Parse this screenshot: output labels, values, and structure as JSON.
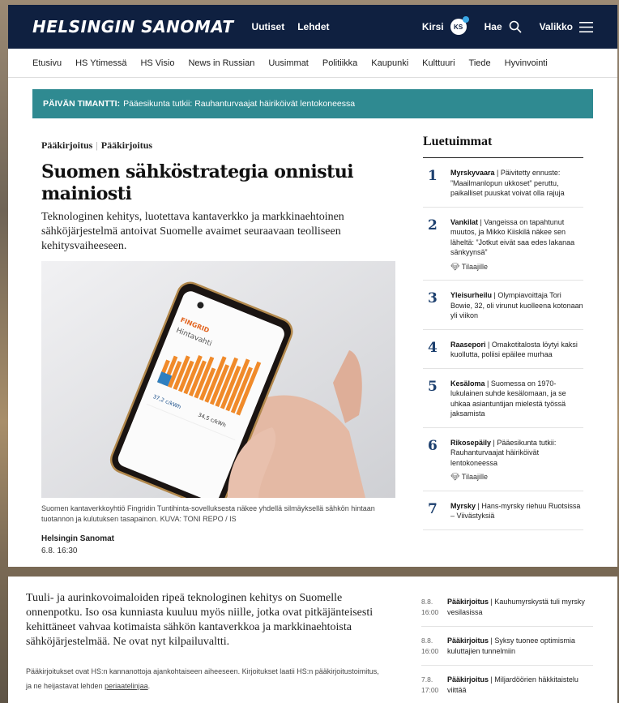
{
  "header": {
    "logo": "HELSINGIN SANOMAT",
    "links": [
      "Uutiset",
      "Lehdet"
    ],
    "user_name": "Kirsi",
    "user_initials": "KS",
    "search_label": "Hae",
    "menu_label": "Valikko"
  },
  "subnav": [
    "Etusivu",
    "HS Ytimessä",
    "HS Visio",
    "News in Russian",
    "Uusimmat",
    "Politiikka",
    "Kaupunki",
    "Kulttuuri",
    "Tiede",
    "Hyvinvointi"
  ],
  "banner": {
    "label": "PÄIVÄN TIMANTTI:",
    "text": "Pääesikunta tutkii: Rauhanturvaajat häiriköivät lentokoneessa"
  },
  "article": {
    "kicker_1": "Pääkirjoitus",
    "kicker_sep": "|",
    "kicker_2": "Pääkirjoitus",
    "title": "Suomen sähköstrategia onnistui mainiosti",
    "lead": "Teknologinen kehitys, luotettava kantaverkko ja markkinaehtoinen sähköjärjestelmä antoivat Suomelle avaimet seuraavaan teolliseen kehitysvaiheeseen.",
    "image": {
      "app_brand": "FINGRID",
      "app_title": "Hintavahti",
      "value_1": "37,2 c/kWh",
      "value_2": "34,5 c/kWh"
    },
    "caption": "Suomen kantaverkkoyhtiö Fingridin Tuntihinta-sovelluksesta näkee yhdellä silmäyksellä sähkön hintaan tuotannon ja kulutuksen tasapainon. KUVA: TONI REPO / IS",
    "byline": "Helsingin Sanomat",
    "date": "6.8. 16:30",
    "body": "Tuuli- ja aurinkovoimaloiden ripeä teknologinen kehitys on Suomelle onnenpotku. Iso osa kunniasta kuuluu myös niille, jotka ovat pitkäjänteisesti kehittäneet vahvaa kotimaista sähkön kantaverkkoa ja markkinaehtoista sähköjärjestelmää. Ne ovat nyt kilpailuvaltti.",
    "note_text": "Pääkirjoitukset ovat HS:n kannanottoja ajankohtaiseen aiheeseen. Kirjoitukset laatii HS:n pääkirjoitustoimitus, ja ne heijastavat lehden",
    "note_link": "periaatelinjaa",
    "note_end": "."
  },
  "most_read": {
    "title": "Luetuimmat",
    "subscriber_label": "Tilaajille",
    "items": [
      {
        "num": "1",
        "section": "Myrskyvaara",
        "text": " | Päivitetty ennuste: ”Maailmanlopun ukkoset” peruttu, paikalliset puuskat voivat olla rajuja"
      },
      {
        "num": "2",
        "section": "Vankilat",
        "text": " | Vangeissa on tapahtunut muutos, ja Mikko Kiiskilä näkee sen läheltä: ”Jotkut eivät saa edes lakanaa sänkyynsä”"
      },
      {
        "num": "3",
        "section": "Yleisurheilu",
        "text": " | Olympiavoittaja Tori Bowie, 32, oli virunut kuolleena kotonaan yli viikon"
      },
      {
        "num": "4",
        "section": "Raasepori",
        "text": " | Omakotitalosta löytyi kaksi kuollutta, poliisi epäilee murhaa"
      },
      {
        "num": "5",
        "section": "Kesäloma",
        "text": " | Suomessa on 1970-lukulainen suhde kesälomaan, ja se uhkaa asiantuntijan mielestä työssä jaksamista"
      },
      {
        "num": "6",
        "section": "Rikosepäily",
        "text": " | Pääesikunta tutkii: Rauhanturvaajat häiriköivät lentokoneessa"
      },
      {
        "num": "7",
        "section": "Myrsky",
        "text": " | Hans-myrsky riehuu Ruotsissa – Viivästyksiä"
      }
    ]
  },
  "latest": [
    {
      "date": "8.8.",
      "time": "16:00",
      "section": "Pääkirjoitus",
      "text": " | Kauhumyrskystä tuli myrsky vesilasissa"
    },
    {
      "date": "8.8.",
      "time": "16:00",
      "section": "Pääkirjoitus",
      "text": " | Syksy tuonee optimismia kuluttajien tunnelmiin"
    },
    {
      "date": "7.8.",
      "time": "17:00",
      "section": "Pääkirjoitus",
      "text": " | Miljardöörien häkkitaistelu viittää"
    }
  ]
}
